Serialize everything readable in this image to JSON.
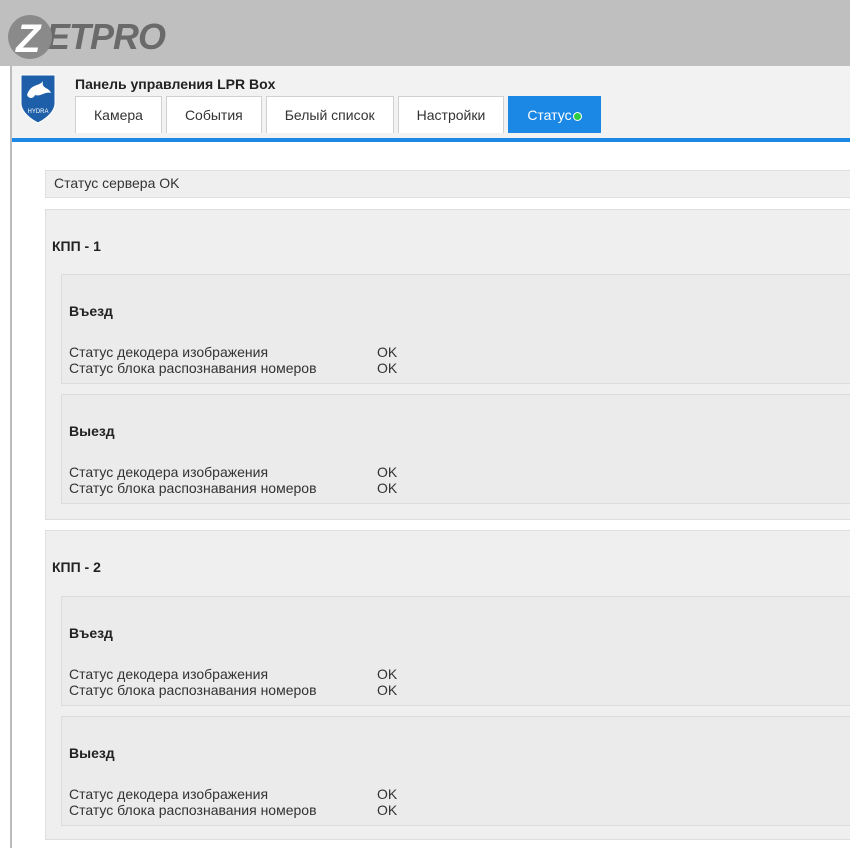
{
  "brand": {
    "logo_text": "ZETPRO",
    "shield_text": "HYDRA"
  },
  "panel": {
    "title": "Панель управления LPR Box"
  },
  "tabs": [
    {
      "label": "Камера",
      "active": false
    },
    {
      "label": "События",
      "active": false
    },
    {
      "label": "Белый список",
      "active": false
    },
    {
      "label": "Настройки",
      "active": false
    },
    {
      "label": "Статус",
      "active": true,
      "indicator": "green-dot"
    }
  ],
  "server_status": "Статус сервера OK",
  "checkpoints": [
    {
      "title": "КПП - 1",
      "entry": {
        "title": "Въезд",
        "rows": [
          {
            "label": "Статус декодера изображения",
            "value": "OK"
          },
          {
            "label": "Статус блока распознавания номеров",
            "value": "OK"
          }
        ]
      },
      "exit": {
        "title": "Выезд",
        "rows": [
          {
            "label": "Статус декодера изображения",
            "value": "OK"
          },
          {
            "label": "Статус блока распознавания номеров",
            "value": "OK"
          }
        ]
      }
    },
    {
      "title": "КПП - 2",
      "entry": {
        "title": "Въезд",
        "rows": [
          {
            "label": "Статус декодера изображения",
            "value": "OK"
          },
          {
            "label": "Статус блока распознавания номеров",
            "value": "OK"
          }
        ]
      },
      "exit": {
        "title": "Выезд",
        "rows": [
          {
            "label": "Статус декодера изображения",
            "value": "OK"
          },
          {
            "label": "Статус блока распознавания номеров",
            "value": "OK"
          }
        ]
      }
    }
  ],
  "colors": {
    "accent": "#1b88e6",
    "status_ok_dot": "#2ecc40"
  }
}
